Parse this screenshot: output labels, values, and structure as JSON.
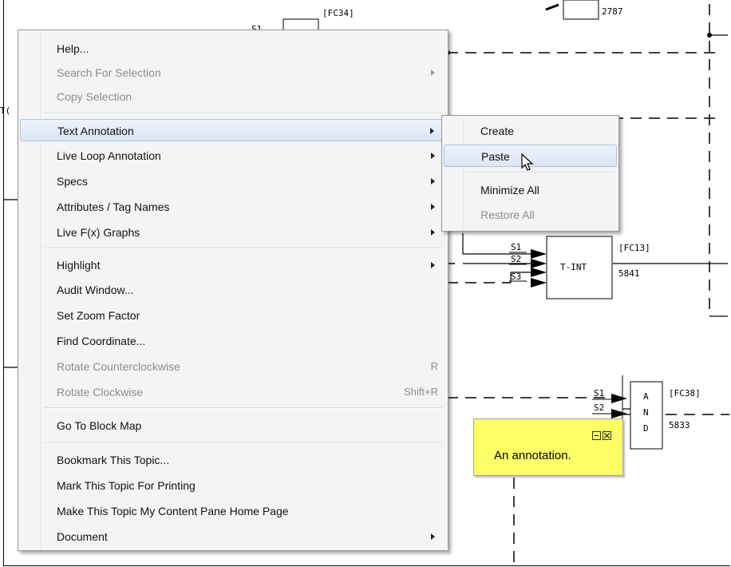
{
  "diagram": {
    "blocks": [
      {
        "name": "fc34",
        "tag": "[FC34]",
        "pin": "S1"
      },
      {
        "name": "top-right",
        "number": "2787"
      },
      {
        "name": "t-int",
        "tag": "[FC13]",
        "label": "T-INT",
        "number": "5841",
        "inputs": [
          "S1",
          "S2",
          "S3"
        ]
      },
      {
        "name": "and",
        "tag": "[FC38]",
        "letters": [
          "A",
          "N",
          "D"
        ],
        "number": "5833",
        "inputs": [
          "S1",
          "S2"
        ]
      }
    ],
    "partial_left_text": "T("
  },
  "context_menu": {
    "items": [
      {
        "label": "Help...",
        "disabled": false,
        "submenu": false
      },
      {
        "label": "Search For Selection",
        "disabled": true,
        "submenu": true
      },
      {
        "label": "Copy Selection",
        "disabled": true,
        "submenu": false
      },
      {
        "label": "Text Annotation",
        "disabled": false,
        "submenu": true,
        "active": true
      },
      {
        "label": "Live Loop Annotation",
        "disabled": false,
        "submenu": true
      },
      {
        "label": "Specs",
        "disabled": false,
        "submenu": true
      },
      {
        "label": "Attributes / Tag Names",
        "disabled": false,
        "submenu": true
      },
      {
        "label": "Live F(x) Graphs",
        "disabled": false,
        "submenu": true
      },
      {
        "label": "Highlight",
        "disabled": false,
        "submenu": true
      },
      {
        "label": "Audit Window...",
        "disabled": false,
        "submenu": false
      },
      {
        "label": "Set Zoom Factor",
        "disabled": false,
        "submenu": false
      },
      {
        "label": "Find Coordinate...",
        "disabled": false,
        "submenu": false
      },
      {
        "label": "Rotate Counterclockwise",
        "disabled": true,
        "submenu": false,
        "shortcut": "R"
      },
      {
        "label": "Rotate Clockwise",
        "disabled": true,
        "submenu": false,
        "shortcut": "Shift+R"
      },
      {
        "label": "Go To Block Map",
        "disabled": false,
        "submenu": false
      },
      {
        "label": "Bookmark This Topic...",
        "disabled": false,
        "submenu": false
      },
      {
        "label": "Mark This Topic For Printing",
        "disabled": false,
        "submenu": false
      },
      {
        "label": "Make This Topic My Content Pane Home Page",
        "disabled": false,
        "submenu": false
      },
      {
        "label": "Document",
        "disabled": false,
        "submenu": true
      }
    ]
  },
  "submenu": {
    "items": [
      {
        "label": "Create",
        "disabled": false
      },
      {
        "label": "Paste",
        "disabled": false,
        "active": true
      },
      {
        "label": "Minimize All",
        "disabled": false
      },
      {
        "label": "Restore All",
        "disabled": true
      }
    ]
  },
  "annotation": {
    "text": "An annotation.",
    "background": "#fefe66",
    "buttons": [
      "minimize-icon",
      "close-icon"
    ]
  },
  "colors": {
    "menu_bg": "#f4f4f4",
    "highlight": "#dbe6f5",
    "disabled_text": "#8d8d8d"
  }
}
